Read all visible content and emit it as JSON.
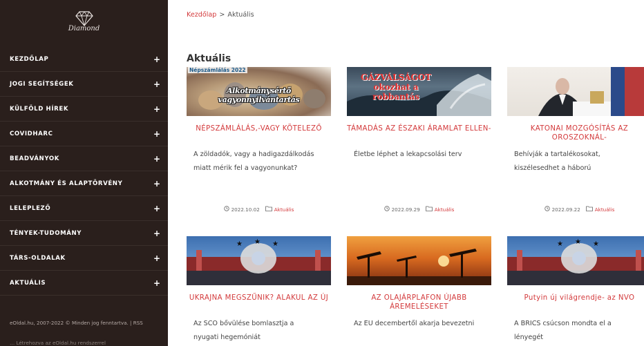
{
  "sidebar": {
    "logo_text": "Diamond",
    "items": [
      {
        "label": "KEZDŐLAP"
      },
      {
        "label": "JOGI SEGÍTSÉGEK"
      },
      {
        "label": "KÜLFÖLD HÍREK"
      },
      {
        "label": "COVIDHARC"
      },
      {
        "label": "BEADVÁNYOK"
      },
      {
        "label": "ALKOTMÁNY ÉS ALAPTÖRVÉNY"
      },
      {
        "label": "LELEPLEZŐ"
      },
      {
        "label": "TÉNYEK-TUDOMÁNY"
      },
      {
        "label": "TÁRS-OLDALAK"
      },
      {
        "label": "AKTUÁLIS"
      }
    ],
    "expand_symbol": "+",
    "footer": "eOldal.hu, 2007-2022 © Minden jog fenntartva. | RSS",
    "footer_cut": "… Létrehozva az eOldal.hu rendszerrel"
  },
  "breadcrumb": {
    "home": "Kezdőlap",
    "separator": ">",
    "current": "Aktuális"
  },
  "page_title": "Aktuális",
  "cards": [
    {
      "title": "NÉPSZÁMLÁLÁS,-VAGY KÖTELEZŐ",
      "excerpt": "A zöldadók, vagy a hadigazdálkodás miatt mérik fel a vagyonunkat?",
      "date": "2022.10.02",
      "category": "Aktuális",
      "image_caption_top": "Népszámlálás 2022",
      "image_caption_main": "Alkotmánysértő vagyonnyilvántartás"
    },
    {
      "title": "TÁMADÁS AZ ÉSZAKI ÁRAMLAT ELLEN-",
      "excerpt": "Életbe léphet a lekapcsolási terv",
      "date": "2022.09.29",
      "category": "Aktuális",
      "image_caption_main": "GÁZVÁLSÁGOT okozhat a robbantás"
    },
    {
      "title": "KATONAI MOZGÓSÍTÁS AZ OROSZOKNÁL-",
      "excerpt": "Behívják a tartalékosokat, kiszélesedhet a háború",
      "date": "2022.09.22",
      "category": "Aktuális"
    },
    {
      "title": "UKRAJNA MEGSZŰNIK? ALAKUL AZ ÚJ",
      "excerpt": "Az SCO bővülése bomlasztja a nyugati hegemóniát",
      "date": "",
      "category": ""
    },
    {
      "title": "AZ OLAJÁRPLAFON ÚJABB ÁREMELÉSEKET",
      "excerpt": "Az EU decembertől akarja bevezetni",
      "date": "",
      "category": ""
    },
    {
      "title": "Putyin új világrendje- az NVO",
      "excerpt": "A BRICS csúcson mondta el a lényegét",
      "date": "",
      "category": ""
    }
  ],
  "colors": {
    "sidebar_bg": "#2a1f1c",
    "accent": "#d3393b",
    "text": "#444444"
  }
}
